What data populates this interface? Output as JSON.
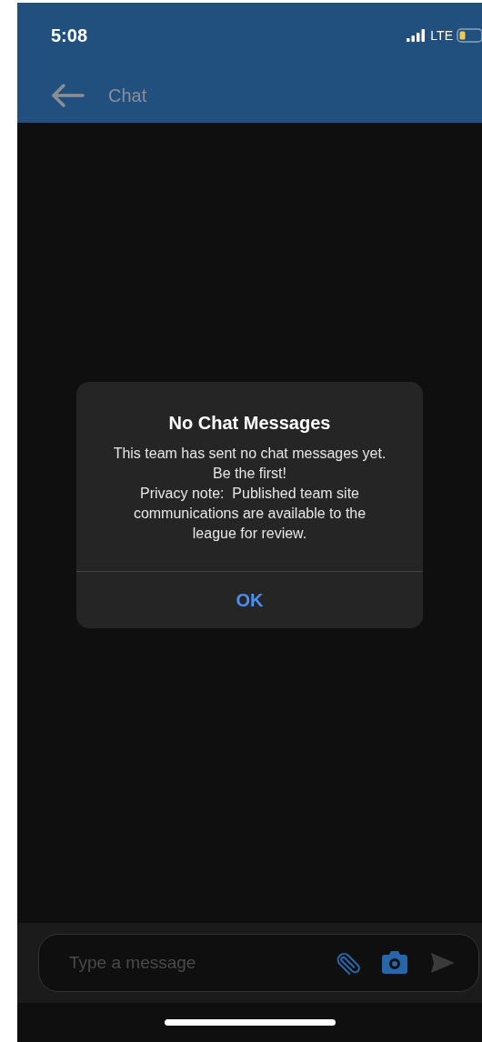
{
  "status_bar": {
    "time": "5:08",
    "network": "LTE"
  },
  "nav_bar": {
    "title": "Chat"
  },
  "dialog": {
    "title": "No Chat Messages",
    "message": "This team has sent no chat messages yet. Be the first!\nPrivacy note:  Published team site communications are available to the league for review.",
    "buttons": [
      "OK"
    ]
  },
  "composer": {
    "placeholder": "Type a message"
  }
}
